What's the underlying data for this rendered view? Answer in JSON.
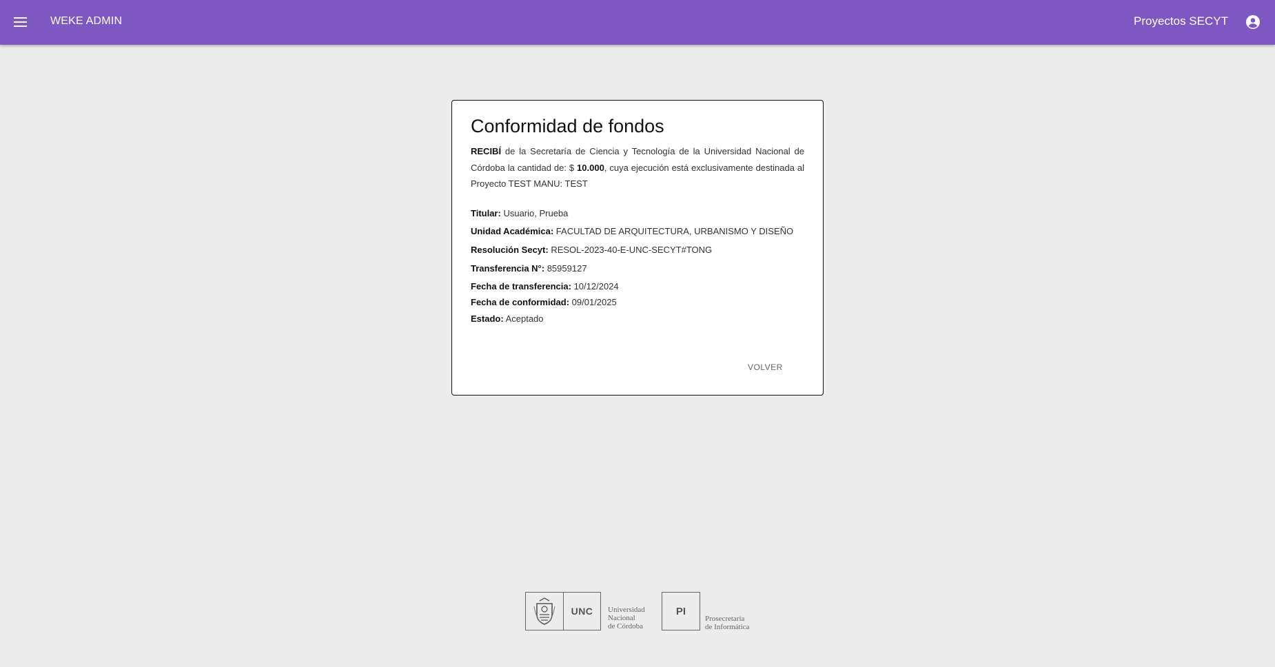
{
  "header": {
    "app_title": "WEKE ADMIN",
    "section_title": "Proyectos SECYT",
    "bar_color": "#7e57c2",
    "menu_icon": "menu-icon",
    "account_icon": "account-circle-icon"
  },
  "card": {
    "title": "Conformidad de fondos",
    "intro": {
      "recibi": "RECIBÍ",
      "text_1": " de la Secretaría de Ciencia y Tecnología de la Universidad Nacional de Córdoba la cantidad de: $ ",
      "amount": "10.000",
      "text_2": ", cuya ejecución está exclusivamente destinada al Proyecto TEST MANU: TEST"
    },
    "fields": [
      {
        "label": "Titular:",
        "value": "Usuario, Prueba"
      },
      {
        "label": "Unidad Académica:",
        "value": "FACULTAD DE ARQUITECTURA, URBANISMO Y DISEÑO"
      },
      {
        "label": "Resolución Secyt:",
        "value": "RESOL-2023-40-E-UNC-SECYT#TONG"
      },
      {
        "label": "Transferencia N°:",
        "value": "85959127"
      },
      {
        "label": "Fecha de transferencia:",
        "value": "10/12/2024"
      },
      {
        "label": "Fecha de conformidad:",
        "value": "09/01/2025"
      },
      {
        "label": "Estado:",
        "value": "Aceptado"
      }
    ],
    "back_label": "VOLVER"
  },
  "footer": {
    "unc_logo_text": "UNC",
    "unc_caption": [
      "Universidad",
      "Nacional",
      "de Córdoba"
    ],
    "pi_logo_text": "PI",
    "pi_caption": [
      "Prosecretaría",
      "de Informática"
    ]
  }
}
